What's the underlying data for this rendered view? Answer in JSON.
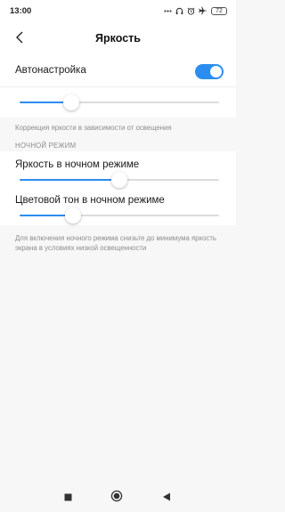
{
  "status_bar": {
    "time": "13:00",
    "icons": [
      "dots-icon",
      "headphones-icon",
      "alarm-icon",
      "airplane-icon",
      "battery-icon"
    ],
    "battery": "72"
  },
  "header": {
    "title": "Яркость",
    "back_icon": "chevron-left-icon"
  },
  "auto": {
    "label": "Автонастройка",
    "enabled": true,
    "slider_value": 0.26,
    "caption": "Коррекция яркости в зависимости от освещения"
  },
  "night_mode": {
    "section_title": "НОЧНОЙ РЕЖИМ",
    "brightness_label": "Яркость в ночном режиме",
    "brightness_value": 0.5,
    "tone_label": "Цветовой тон в ночном режиме",
    "tone_value": 0.27,
    "caption": "Для включения ночного режима снизьте до минимума яркость экрана в условиях низкой освещенности"
  },
  "nav": {
    "buttons": [
      "recents-icon",
      "home-icon",
      "back-icon"
    ]
  },
  "colors": {
    "accent": "#2c8df1",
    "background": "#f7f7f7",
    "caption": "#8d8d8d"
  }
}
